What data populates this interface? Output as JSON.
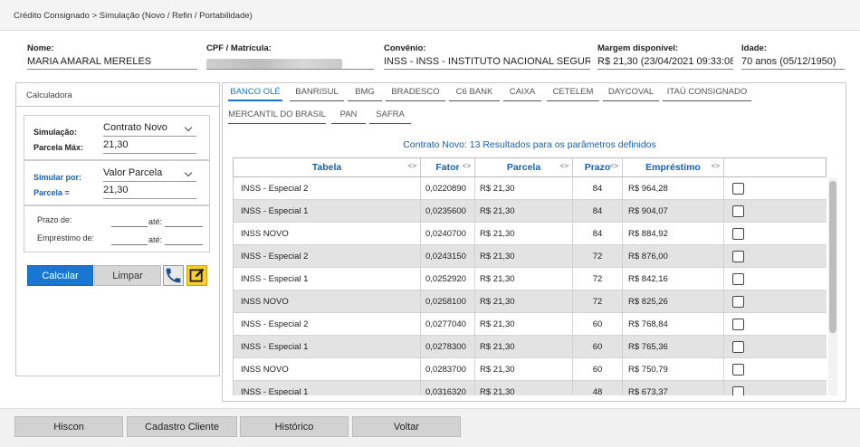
{
  "breadcrumb": "Crédito Consignado > Simulação (Novo / Refin / Portabilidade)",
  "header": {
    "nome_label": "Nome:",
    "nome_value": "MARIA AMARAL MERELES",
    "cpf_label": "CPF / Matrícula:",
    "convenio_label": "Convênio:",
    "convenio_value": "INSS - INSS - INSTITUTO NACIONAL SEGURIDADE SOCIAL",
    "margem_label": "Margem disponível:",
    "margem_value": "R$ 21,30 (23/04/2021 09:33:08)",
    "idade_label": "Idade:",
    "idade_value": "70 anos (05/12/1950)"
  },
  "calculadora": {
    "title": "Calculadora",
    "simulacao_label": "Simulação:",
    "simulacao_value": "Contrato Novo",
    "parcela_max_label": "Parcela Máx:",
    "parcela_max_value": "21,30",
    "simular_por_label": "Simular por:",
    "simular_por_value": "Valor Parcela",
    "parcela_label": "Parcela =",
    "parcela_value": "21,30",
    "prazo_label": "Prazo de:",
    "emprestimo_label": "Empréstimo de:",
    "ate_label": "até:",
    "calcular_label": "Calcular",
    "limpar_label": "Limpar"
  },
  "banks": {
    "row1": [
      "BANCO OLÉ",
      "BANRISUL",
      "BMG",
      "BRADESCO",
      "C6 BANK",
      "CAIXA",
      "CETELEM",
      "DAYCOVAL",
      "ITAÚ CONSIGNADO"
    ],
    "row2": [
      "MERCANTIL DO BRASIL",
      "PAN",
      "SAFRA"
    ],
    "active": "BANCO OLÉ"
  },
  "results": {
    "title": "Contrato Novo: 13 Resultados para os parâmetros definidos",
    "sort_glyph": "<>",
    "columns": [
      "Tabela",
      "Fator",
      "Parcela",
      "Prazo",
      "Empréstimo"
    ],
    "rows": [
      {
        "tabela": "INSS - Especial 2",
        "fator": "0,0220890",
        "parcela": "R$ 21,30",
        "prazo": "84",
        "emprestimo": "R$ 964,28"
      },
      {
        "tabela": "INSS - Especial 1",
        "fator": "0,0235600",
        "parcela": "R$ 21,30",
        "prazo": "84",
        "emprestimo": "R$ 904,07"
      },
      {
        "tabela": "INSS NOVO",
        "fator": "0,0240700",
        "parcela": "R$ 21,30",
        "prazo": "84",
        "emprestimo": "R$ 884,92"
      },
      {
        "tabela": "INSS - Especial 2",
        "fator": "0,0243150",
        "parcela": "R$ 21,30",
        "prazo": "72",
        "emprestimo": "R$ 876,00"
      },
      {
        "tabela": "INSS - Especial 1",
        "fator": "0,0252920",
        "parcela": "R$ 21,30",
        "prazo": "72",
        "emprestimo": "R$ 842,16"
      },
      {
        "tabela": "INSS NOVO",
        "fator": "0,0258100",
        "parcela": "R$ 21,30",
        "prazo": "72",
        "emprestimo": "R$ 825,26"
      },
      {
        "tabela": "INSS - Especial 2",
        "fator": "0,0277040",
        "parcela": "R$ 21,30",
        "prazo": "60",
        "emprestimo": "R$ 768,84"
      },
      {
        "tabela": "INSS - Especial 1",
        "fator": "0,0278300",
        "parcela": "R$ 21,30",
        "prazo": "60",
        "emprestimo": "R$ 765,36"
      },
      {
        "tabela": "INSS NOVO",
        "fator": "0,0283700",
        "parcela": "R$ 21,30",
        "prazo": "60",
        "emprestimo": "R$ 750,79"
      },
      {
        "tabela": "INSS - Especial 1",
        "fator": "0,0316320",
        "parcela": "R$ 21,30",
        "prazo": "48",
        "emprestimo": "R$ 673,37"
      }
    ]
  },
  "footer": {
    "hiscon": "Hiscon",
    "cadastro": "Cadastro Cliente",
    "historico": "Histórico",
    "voltar": "Voltar"
  },
  "colors": {
    "accent": "#1976d2",
    "results_text": "#1a5fb0",
    "edit_icon": "#f7cf2c"
  }
}
